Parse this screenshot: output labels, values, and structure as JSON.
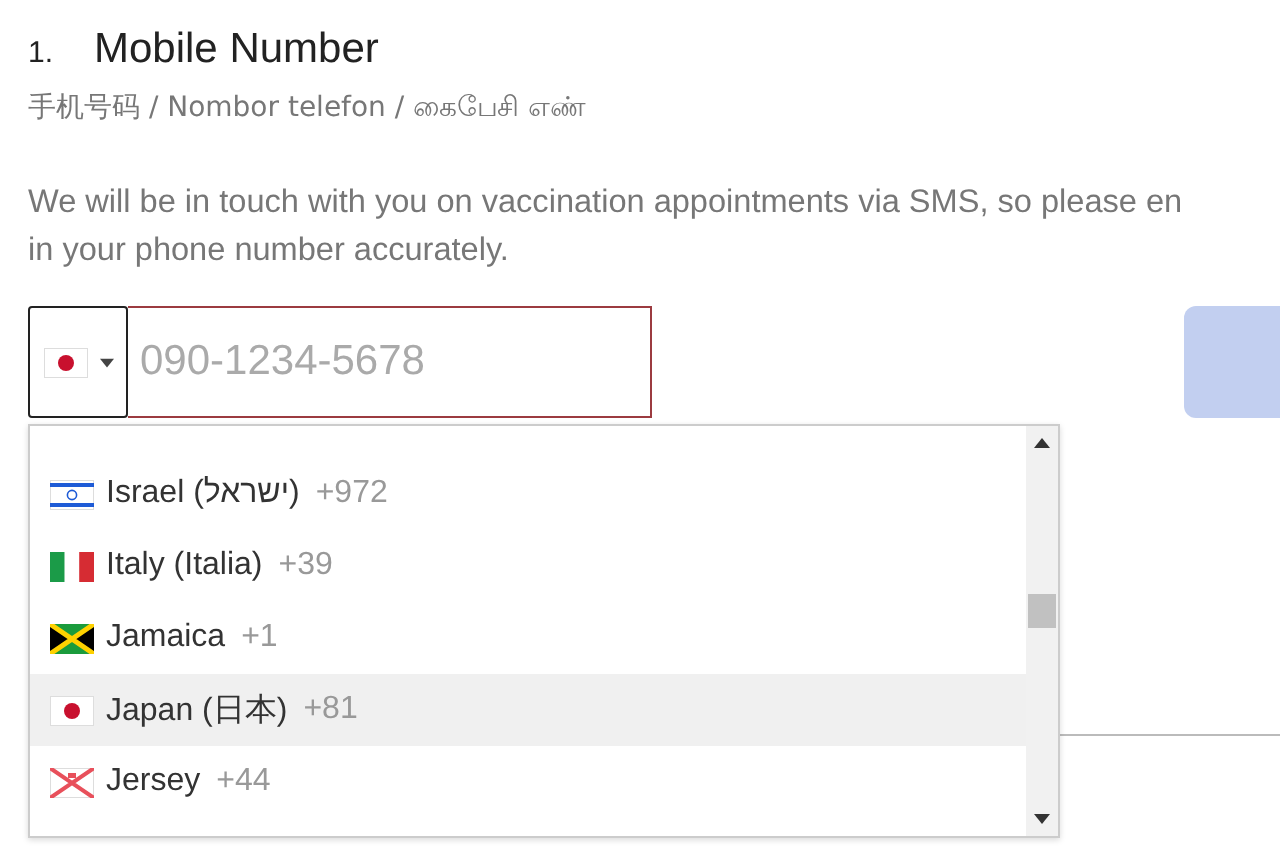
{
  "heading": {
    "number": "1.",
    "title": "Mobile Number"
  },
  "subtitle": "手机号码 / Nombor telefon / கைபேசி எண்",
  "description": [
    "We will be in touch with you on vaccination appointments via SMS, so please en",
    "in your phone number accurately."
  ],
  "phone": {
    "placeholder": "090-1234-5678"
  },
  "countries": [
    {
      "name": "Israel (ישראל)",
      "code": "+972",
      "kind": "il",
      "selected": false
    },
    {
      "name": "Italy (Italia)",
      "code": "+39",
      "kind": "it",
      "selected": false
    },
    {
      "name": "Jamaica",
      "code": "+1",
      "kind": "jm",
      "selected": false
    },
    {
      "name": "Japan (日本)",
      "code": "+81",
      "kind": "jp",
      "selected": true
    },
    {
      "name": "Jersey",
      "code": "+44",
      "kind": "je",
      "selected": false
    }
  ]
}
